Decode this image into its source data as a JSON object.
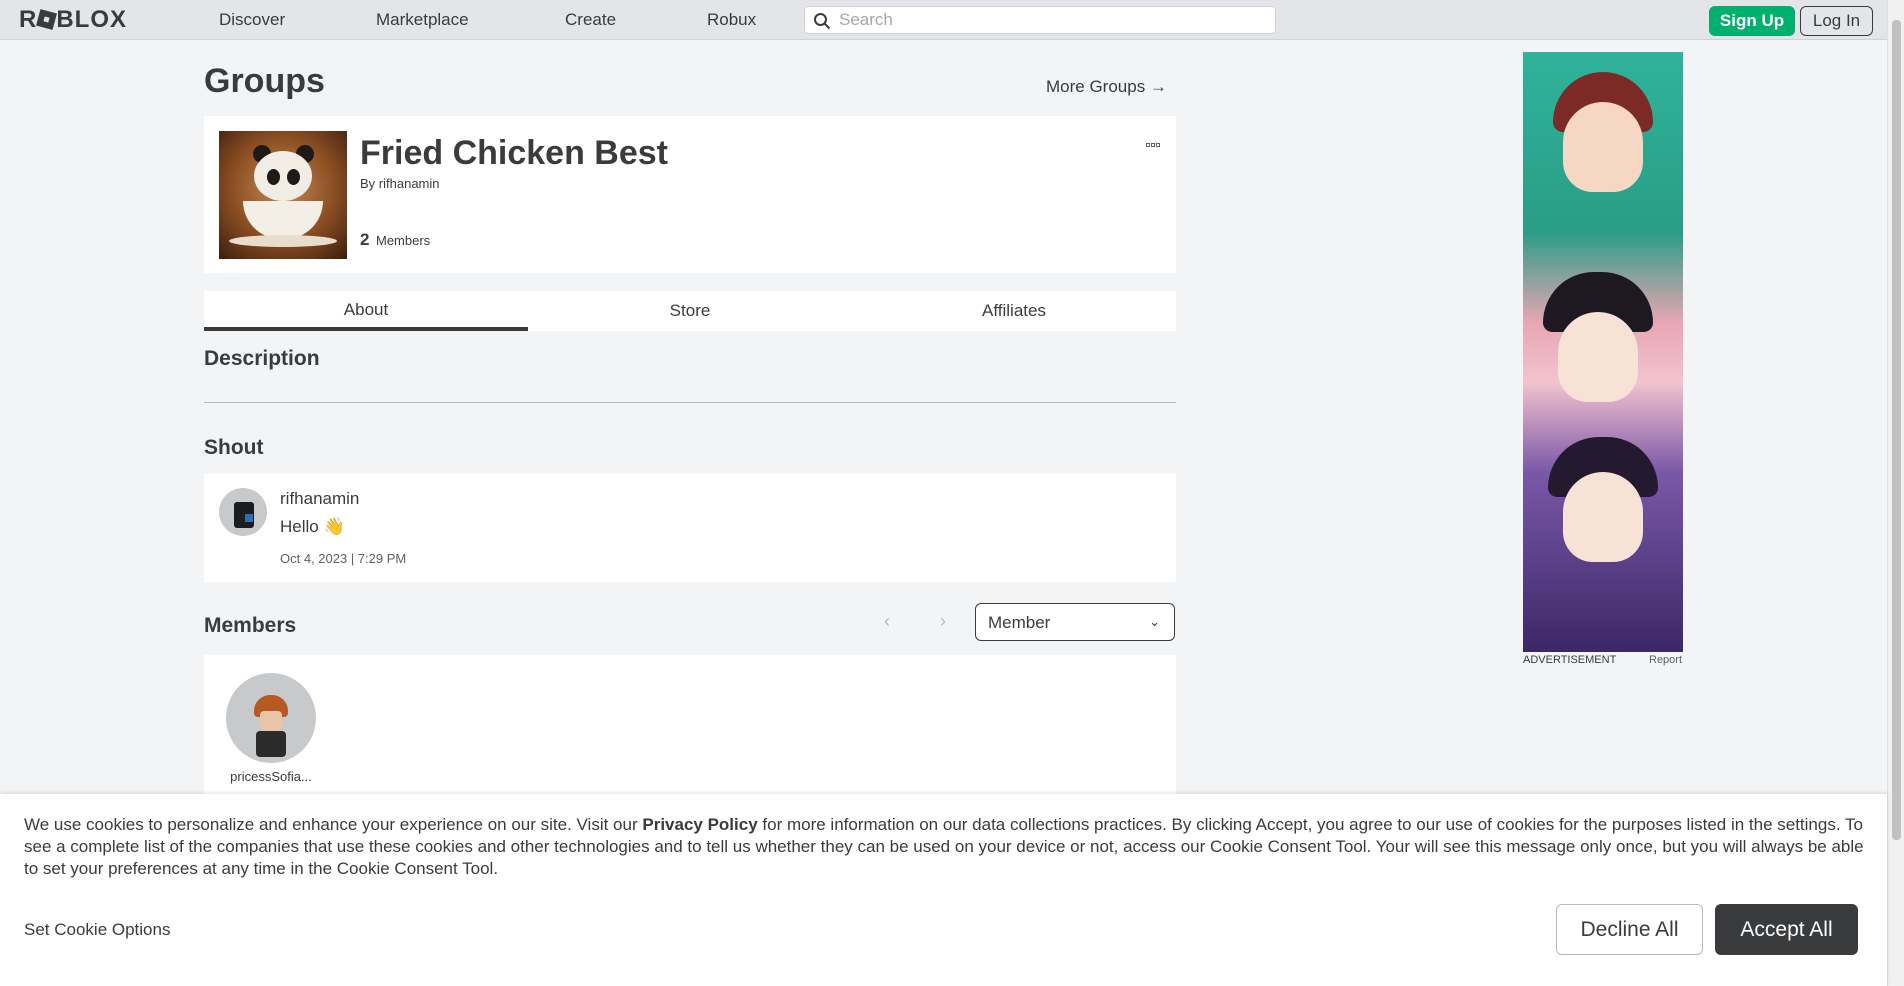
{
  "topbar": {
    "logo": "ROBLOX",
    "nav": [
      "Discover",
      "Marketplace",
      "Create",
      "Robux"
    ],
    "search_placeholder": "Search",
    "signup_label": "Sign Up",
    "login_label": "Log In",
    "accent_color": "#00b06f"
  },
  "page": {
    "title": "Groups",
    "more_groups": "More Groups →"
  },
  "group": {
    "name": "Fried Chicken Best",
    "by_label": "By",
    "owner": "rifhanamin",
    "member_count": "2",
    "members_label": "Members",
    "thumbnail_icon": "panda-teacup-image",
    "menu_icon": "more-options-icon"
  },
  "tabs": [
    {
      "label": "About",
      "active": true
    },
    {
      "label": "Store",
      "active": false
    },
    {
      "label": "Affiliates",
      "active": false
    }
  ],
  "description": {
    "heading": "Description"
  },
  "shout": {
    "heading": "Shout",
    "user": "rifhanamin",
    "message": "Hello 👋",
    "date": "Oct 4, 2023 | 7:29 PM"
  },
  "members": {
    "heading": "Members",
    "prev_icon": "chevron-left-icon",
    "next_icon": "chevron-right-icon",
    "role_selected": "Member",
    "list": [
      {
        "name": "pricessSofia..."
      }
    ]
  },
  "ad": {
    "label": "ADVERTISEMENT",
    "report": "Report"
  },
  "cookie": {
    "text_before": "We use cookies to personalize and enhance your experience on our site. Visit our ",
    "privacy_link": "Privacy Policy",
    "text_after": " for more information on our data collections practices. By clicking Accept, you agree to our use of cookies for the purposes listed in the settings. To see a complete list of the companies that use these cookies and other technologies and to tell us whether they can be used on your device or not, access our Cookie Consent Tool. Your will see this message only once, but you will always be able to set your preferences at any time in the Cookie Consent Tool.",
    "options_label": "Set Cookie Options",
    "decline_label": "Decline All",
    "accept_label": "Accept All"
  }
}
